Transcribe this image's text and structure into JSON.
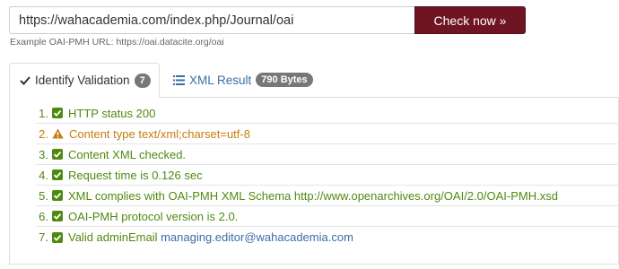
{
  "search": {
    "url_value": "https://wahacademia.com/index.php/Journal/oai",
    "button_label": "Check now »",
    "example_text": "Example OAI-PMH URL: https://oai.datacite.org/oai"
  },
  "tabs": [
    {
      "label": "Identify Validation",
      "badge": "7",
      "icon": "check-icon",
      "active": true
    },
    {
      "label": "XML Result",
      "badge": "790 Bytes",
      "icon": "list-icon",
      "active": false
    }
  ],
  "results": [
    {
      "number": "1.",
      "status": "ok",
      "text": "HTTP status 200"
    },
    {
      "number": "2.",
      "status": "warning",
      "text": "Content type text/xml;charset=utf-8"
    },
    {
      "number": "3.",
      "status": "ok",
      "text": "Content XML checked."
    },
    {
      "number": "4.",
      "status": "ok",
      "text": "Request time is 0.126 sec"
    },
    {
      "number": "5.",
      "status": "ok",
      "text": "XML complies with OAI-PMH XML Schema http://www.openarchives.org/OAI/2.0/OAI-PMH.xsd"
    },
    {
      "number": "6.",
      "status": "ok",
      "text": "OAI-PMH protocol version is 2.0."
    },
    {
      "number": "7.",
      "status": "ok",
      "text": "Valid adminEmail ",
      "link": "managing.editor@wahacademia.com"
    }
  ],
  "colors": {
    "accent": "#6e1423",
    "ok": "#4f8a10",
    "warning": "#c77c0e",
    "link": "#3a6ea5",
    "badge": "#777777"
  }
}
